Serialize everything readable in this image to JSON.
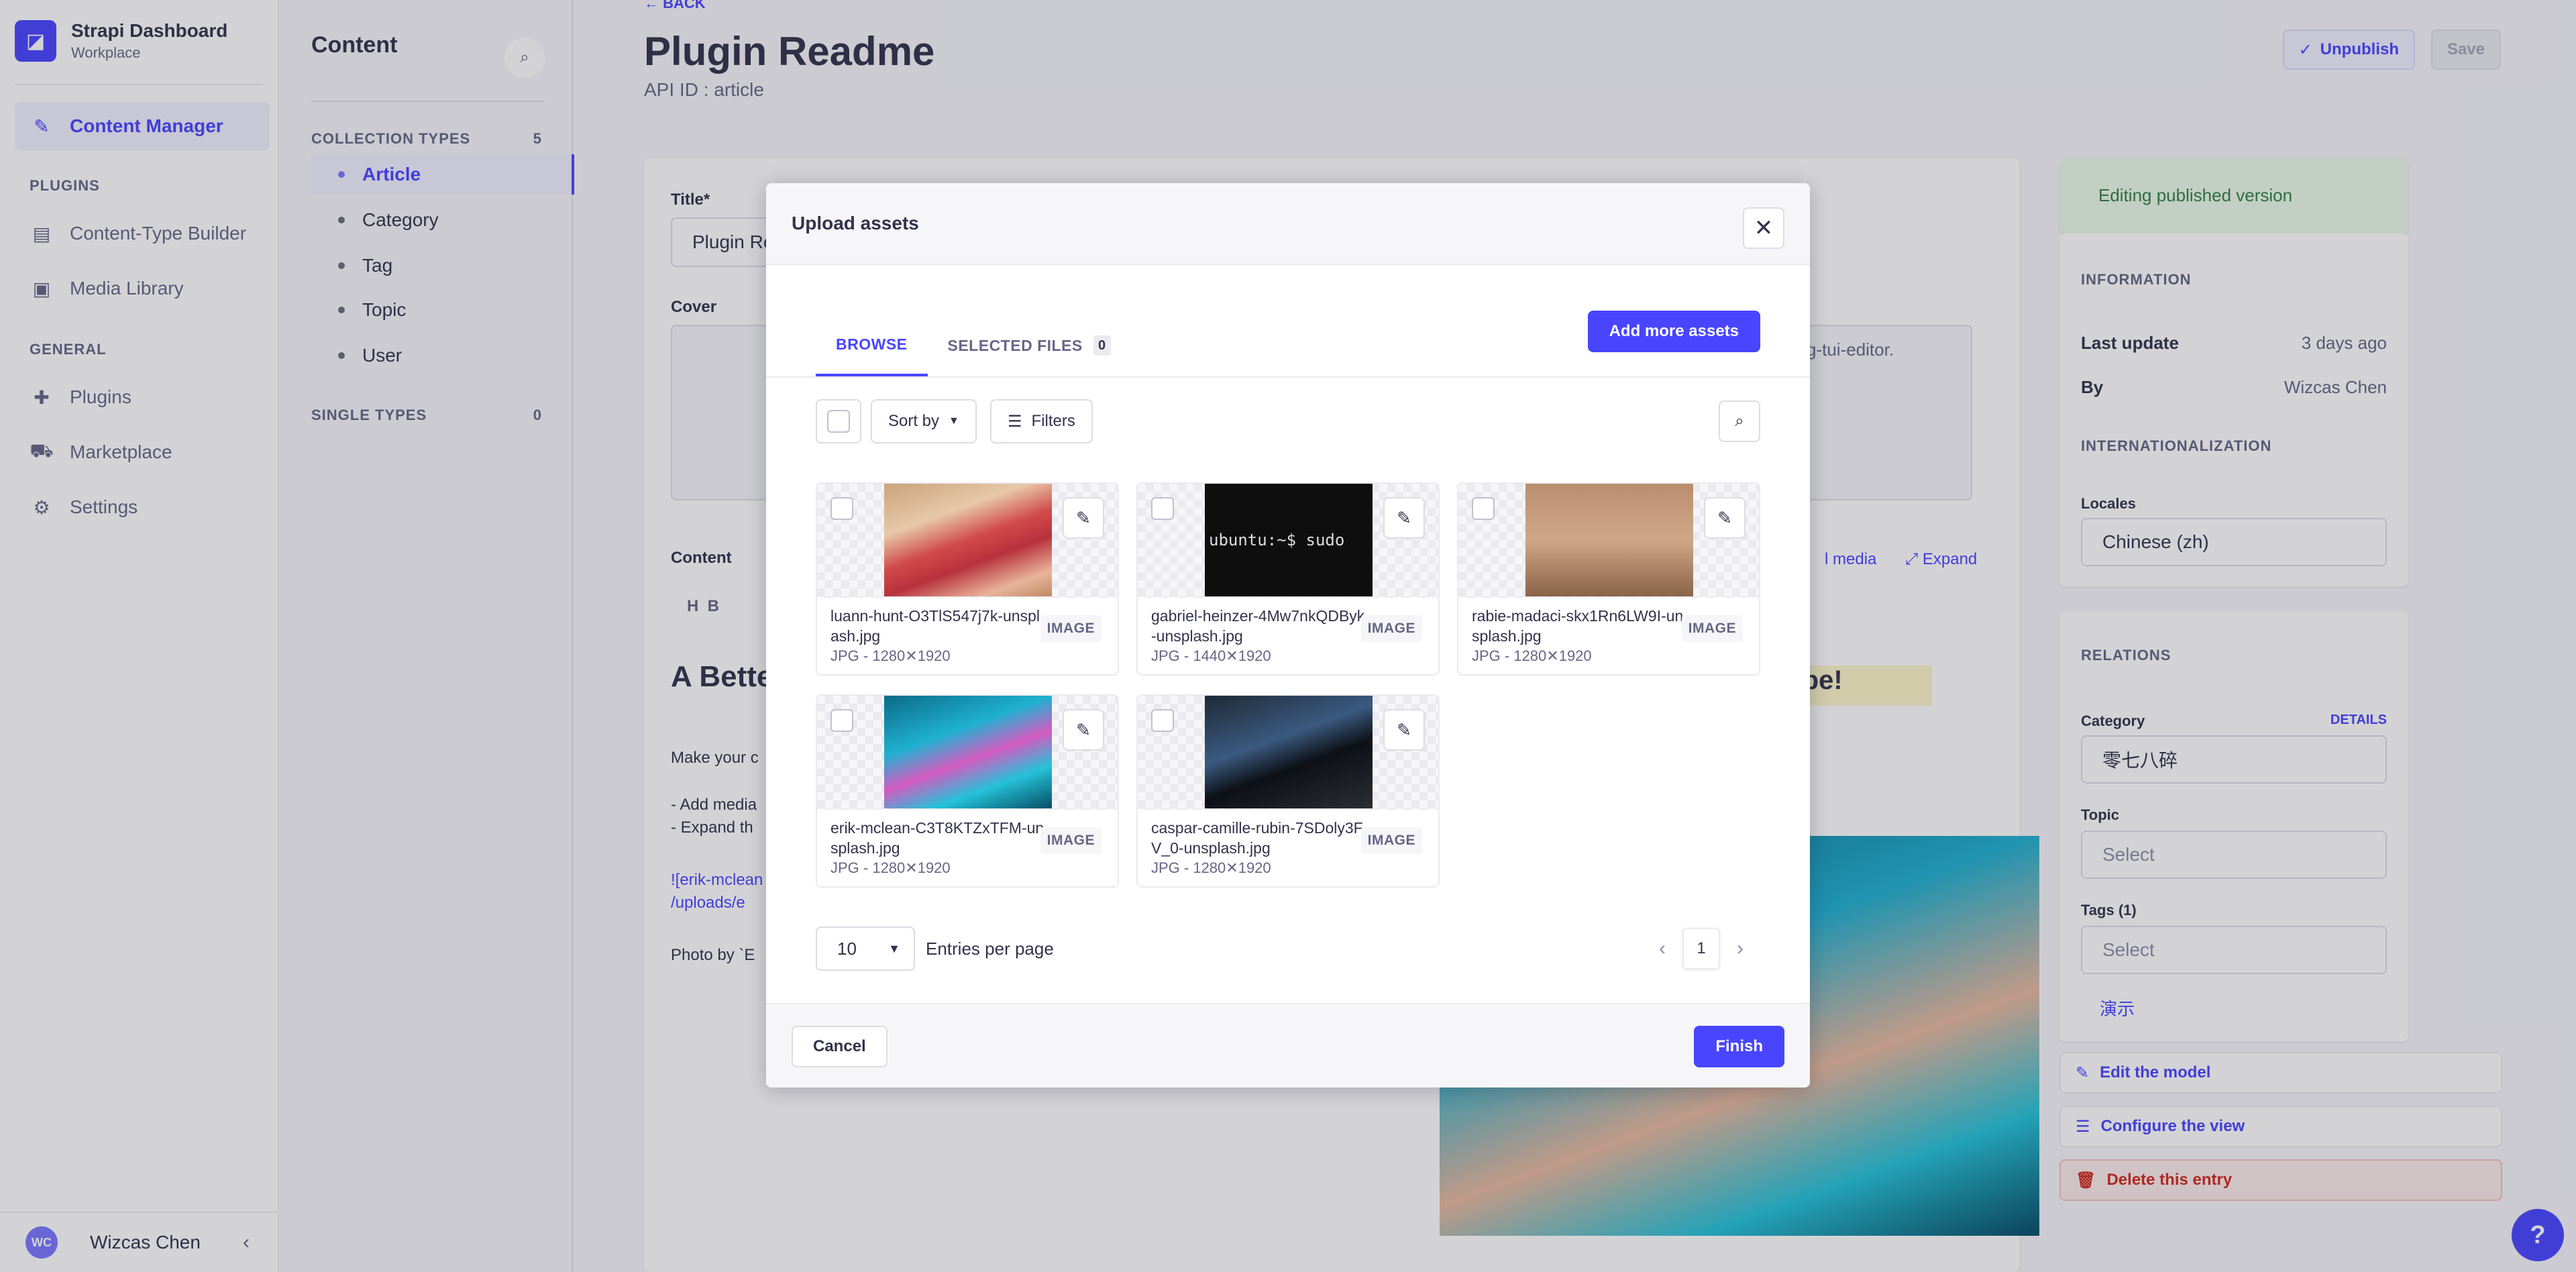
{
  "app": {
    "name": "Strapi Dashboard",
    "workspace": "Workplace"
  },
  "sidebar": {
    "items": [
      {
        "label": "Content Manager",
        "icon": "pencil-icon"
      },
      {
        "label": "Content-Type Builder",
        "icon": "layers-icon"
      },
      {
        "label": "Media Library",
        "icon": "image-icon"
      },
      {
        "label": "Plugins",
        "icon": "puzzle-icon"
      },
      {
        "label": "Marketplace",
        "icon": "shopping-cart-icon"
      },
      {
        "label": "Settings",
        "icon": "gear-icon"
      }
    ],
    "sections": {
      "plugins": "PLUGINS",
      "general": "GENERAL"
    },
    "user": {
      "initials": "WC",
      "name": "Wizcas Chen"
    }
  },
  "subnav": {
    "title": "Content",
    "collection_types_label": "COLLECTION TYPES",
    "collection_types_count": "5",
    "collection_types": [
      "Article",
      "Category",
      "Tag",
      "Topic",
      "User"
    ],
    "single_types_label": "SINGLE TYPES",
    "single_types_count": "0"
  },
  "editor": {
    "back": "BACK",
    "title": "Plugin Readme",
    "api_id": "API ID : article",
    "unpublish": "Unpublish",
    "save": "Save",
    "title_label": "Title*",
    "title_value": "Plugin Re",
    "cover_label": "Cover",
    "content_label": "Content",
    "heading_preview": "A Bette",
    "body_lines": [
      "Make your c",
      "- Add media",
      "- Expand th",
      "![erik-mclean",
      "/uploads/e",
      "Photo by `E"
    ],
    "side_text": "yg-tui-editor.",
    "ripe": "ripe!",
    "add_media": "l media",
    "expand": "Expand"
  },
  "panel": {
    "editing": "Editing published version",
    "information": "INFORMATION",
    "last_update_label": "Last update",
    "last_update_value": "3 days ago",
    "by_label": "By",
    "by_value": "Wizcas Chen",
    "i18n": "INTERNATIONALIZATION",
    "locales_label": "Locales",
    "locales_value": "Chinese (zh)",
    "relations": "RELATIONS",
    "category_label": "Category",
    "details": "DETAILS",
    "category_value": "零七八碎",
    "topic_label": "Topic",
    "select": "Select",
    "tags_label": "Tags (1)",
    "tag_item": "演示",
    "edit_model": "Edit the model",
    "configure_view": "Configure the view",
    "delete_entry": "Delete this entry"
  },
  "modal": {
    "title": "Upload assets",
    "tabs": [
      {
        "label": "BROWSE"
      },
      {
        "label": "SELECTED FILES",
        "count": "0"
      }
    ],
    "add_more": "Add more assets",
    "sort_by": "Sort by",
    "filters": "Filters",
    "assets": [
      {
        "name": "luann-hunt-O3TlS547j7k-unsplash.jpg",
        "meta": "JPG - 1280✕1920",
        "type": "IMAGE"
      },
      {
        "name": "gabriel-heinzer-4Mw7nkQDByk-unsplash.jpg",
        "meta": "JPG - 1440✕1920",
        "type": "IMAGE",
        "thumb_text": "ubuntu:~$ sudo"
      },
      {
        "name": "rabie-madaci-skx1Rn6LW9I-unsplash.jpg",
        "meta": "JPG - 1280✕1920",
        "type": "IMAGE"
      },
      {
        "name": "erik-mclean-C3T8KTZxTFM-unsplash.jpg",
        "meta": "JPG - 1280✕1920",
        "type": "IMAGE"
      },
      {
        "name": "caspar-camille-rubin-7SDoly3FV_0-unsplash.jpg",
        "meta": "JPG - 1280✕1920",
        "type": "IMAGE"
      }
    ],
    "per_page_value": "10",
    "per_page_label": "Entries per page",
    "current_page": "1",
    "cancel": "Cancel",
    "finish": "Finish"
  },
  "colors": {
    "primary": "#4945ff",
    "neutral_text": "#32324d",
    "muted_text": "#666687",
    "backdrop": "#f6f6f9"
  }
}
